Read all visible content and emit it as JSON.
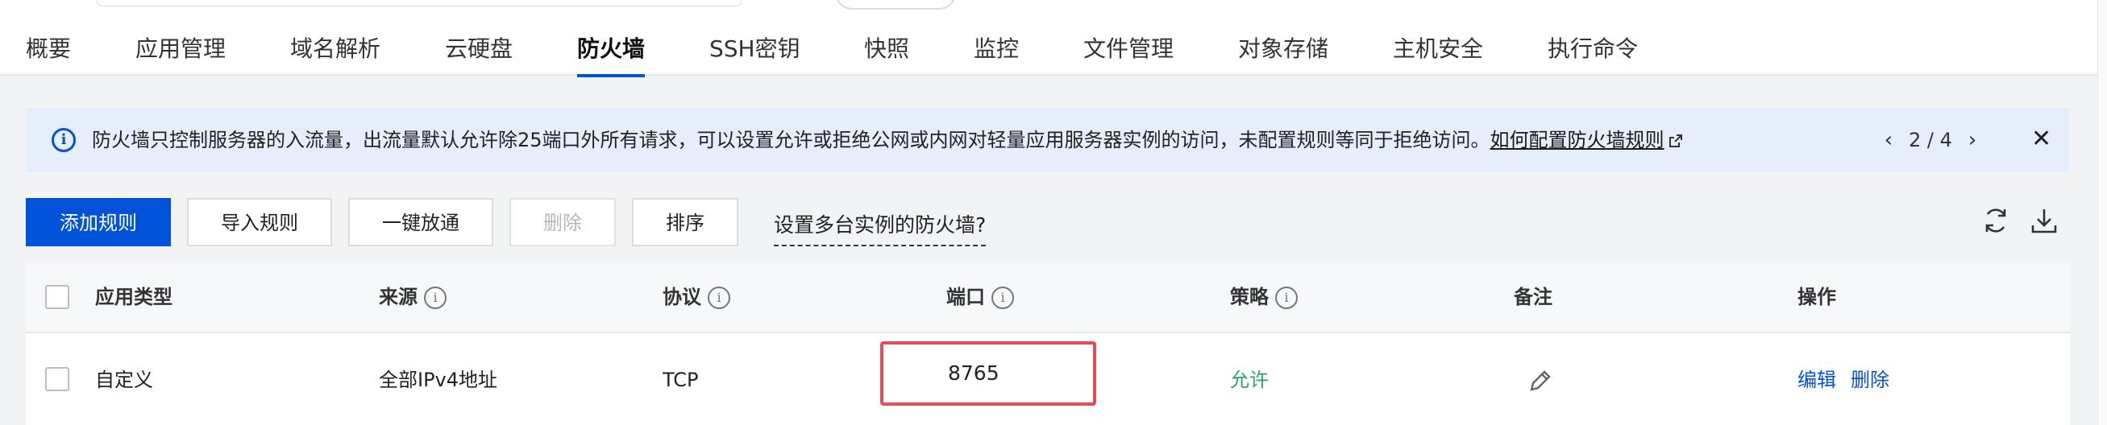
{
  "tabs": [
    {
      "label": "概要"
    },
    {
      "label": "应用管理"
    },
    {
      "label": "域名解析"
    },
    {
      "label": "云硬盘"
    },
    {
      "label": "防火墙",
      "active": true
    },
    {
      "label": "SSH密钥"
    },
    {
      "label": "快照"
    },
    {
      "label": "监控"
    },
    {
      "label": "文件管理"
    },
    {
      "label": "对象存储"
    },
    {
      "label": "主机安全"
    },
    {
      "label": "执行命令"
    }
  ],
  "notice": {
    "icon": "info-icon",
    "text": "防火墙只控制服务器的入流量，出流量默认允许除25端口外所有请求，可以设置允许或拒绝公网或内网对轻量应用服务器实例的访问，未配置规则等同于拒绝访问。",
    "link": "如何配置防火墙规则",
    "pager": "2 / 4"
  },
  "toolbar": {
    "add_rule": "添加规则",
    "import_rules": "导入规则",
    "one_click_open": "一键放通",
    "delete": "删除",
    "sort": "排序",
    "multi_instance": "设置多台实例的防火墙?"
  },
  "table": {
    "headers": {
      "app_type": "应用类型",
      "source": "来源",
      "protocol": "协议",
      "port": "端口",
      "policy": "策略",
      "remark": "备注",
      "actions": "操作"
    },
    "rows": [
      {
        "app_type": "自定义",
        "source": "全部IPv4地址",
        "protocol": "TCP",
        "port": "8765",
        "policy": "允许",
        "remark": "",
        "edit": "编辑",
        "delete": "删除"
      }
    ]
  },
  "colors": {
    "primary": "#0052d9",
    "allow": "#2ba471",
    "highlight": "#e34d59",
    "notice_bg": "#e6edfb"
  }
}
